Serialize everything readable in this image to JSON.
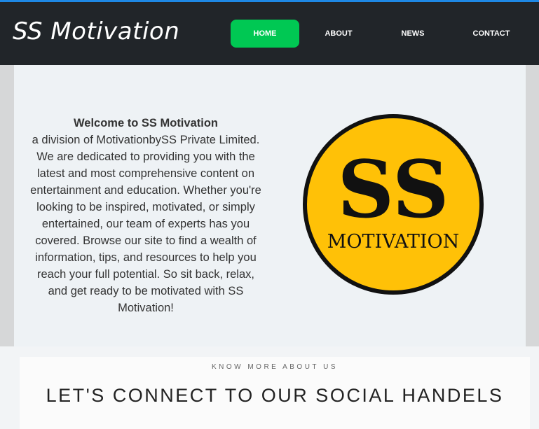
{
  "brand": {
    "name": "SS Motivation"
  },
  "nav": {
    "items": [
      "HOME",
      "ABOUT",
      "NEWS",
      "CONTACT"
    ],
    "active": "HOME"
  },
  "hero": {
    "welcome_title": "Welcome to SS Motivation",
    "welcome_body": "a division of MotivationbySS Private Limited. We are dedicated to providing you with the latest and most comprehensive content on entertainment and education. Whether you're looking to be inspired, motivated, or simply entertained, our team of experts has you covered. Browse our site to find a wealth of information, tips, and resources to help you reach your full potential. So sit back, relax, and get ready to be motivated with SS Motivation!",
    "logo_text_big": "SS",
    "logo_text_small": "MOTIVATION"
  },
  "section": {
    "kicker": "KNOW MORE ABOUT US",
    "headline": "LET'S CONNECT TO OUR SOCIAL HANDELS"
  },
  "colors": {
    "accent": "#00c853",
    "navbar": "#212529",
    "logo_yellow": "#ffc107"
  }
}
